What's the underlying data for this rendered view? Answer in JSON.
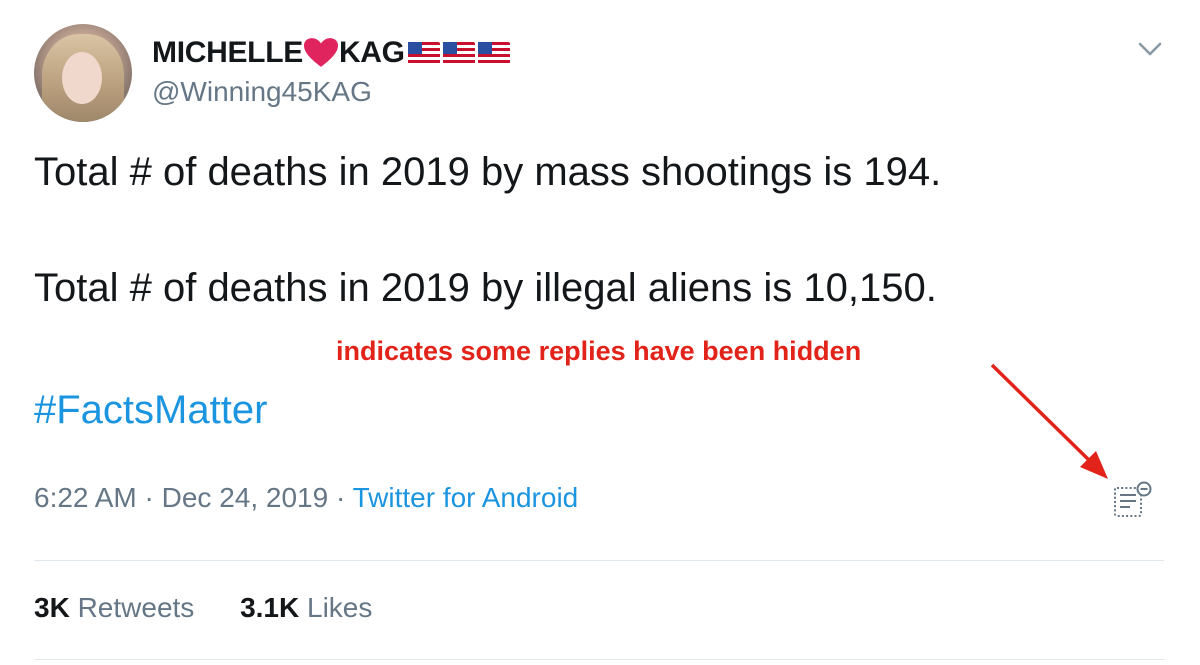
{
  "user": {
    "display_name_prefix": "MICHELLE",
    "display_name_suffix": "KAG",
    "handle": "@Winning45KAG"
  },
  "tweet": {
    "line1": "Total # of deaths in 2019 by mass shootings is 194.",
    "line2": "Total # of deaths in 2019 by illegal aliens is 10,150.",
    "hashtag": "#FactsMatter",
    "time": "6:22 AM",
    "separator": "·",
    "date": "Dec 24, 2019",
    "source": "Twitter for Android"
  },
  "annotation": {
    "text": "indicates some replies have been hidden"
  },
  "stats": {
    "retweets_count": "3K",
    "retweets_label": "Retweets",
    "likes_count": "3.1K",
    "likes_label": "Likes"
  },
  "icons": {
    "heart": "red-heart-emoji",
    "flag": "us-flag-emoji",
    "menu": "chevron-down-icon",
    "hidden_replies": "hidden-replies-icon"
  },
  "colors": {
    "text": "#14171a",
    "secondary": "#657786",
    "link": "#1b95e0",
    "annotation": "#e2231a",
    "heart": "#e0245e"
  }
}
